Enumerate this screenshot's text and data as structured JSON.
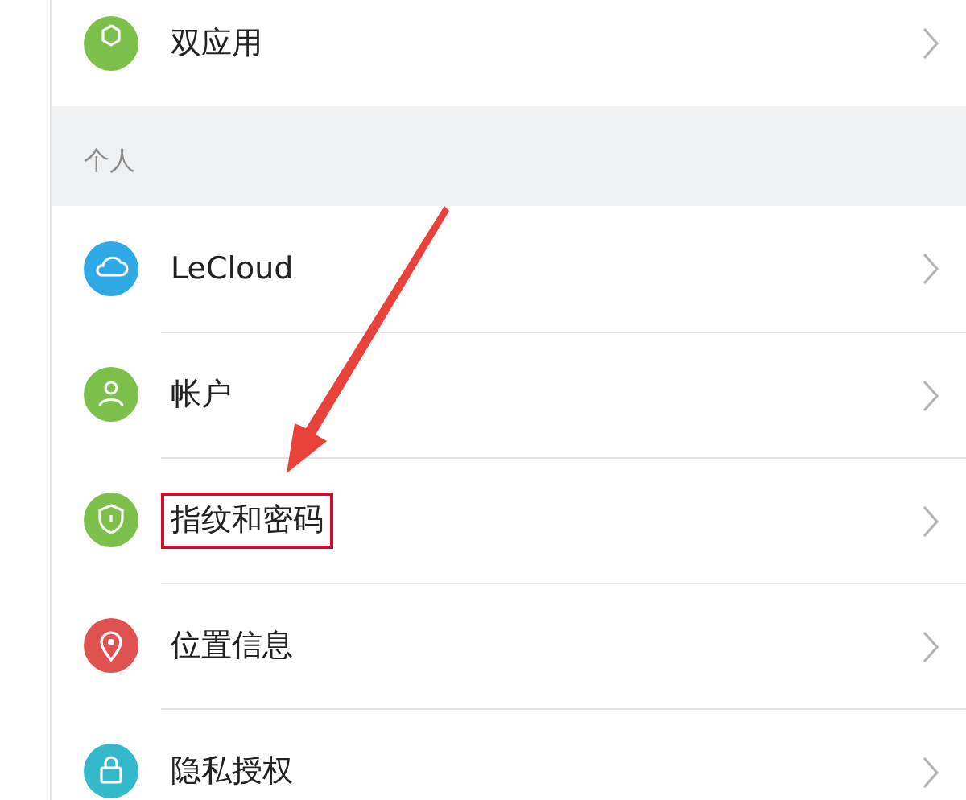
{
  "sections": [
    {
      "items": [
        {
          "label": "双应用",
          "color": "#7cc04b",
          "highlighted": false
        }
      ]
    },
    {
      "header": "个人",
      "items": [
        {
          "label": "LeCloud",
          "color": "#2fa9e6",
          "highlighted": false
        },
        {
          "label": "帐户",
          "color": "#7cc04b",
          "highlighted": false
        },
        {
          "label": "指纹和密码",
          "color": "#7cc04b",
          "highlighted": true
        },
        {
          "label": "位置信息",
          "color": "#e0524f",
          "highlighted": false
        },
        {
          "label": "隐私授权",
          "color": "#33b9c9",
          "highlighted": false
        }
      ]
    }
  ]
}
